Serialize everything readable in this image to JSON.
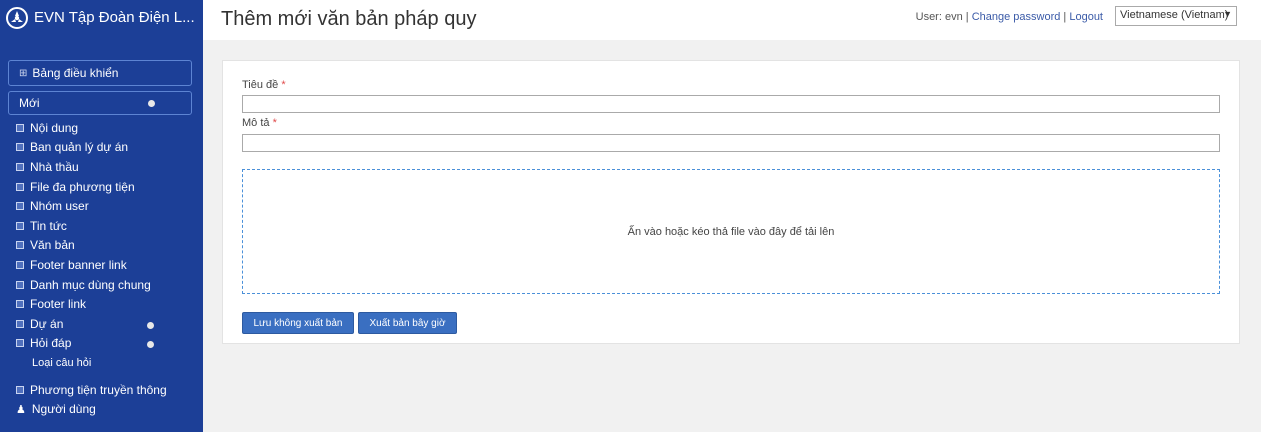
{
  "brand": {
    "title": "EVN Tập Đoàn Điện L..."
  },
  "sidebar": {
    "dashboard_label": "Bảng điều khiển",
    "new_label": "Mới",
    "items": [
      {
        "label": "Nội dung"
      },
      {
        "label": "Ban quản lý dự án"
      },
      {
        "label": "Nhà thầu"
      },
      {
        "label": "File đa phương tiện"
      },
      {
        "label": "Nhóm user"
      },
      {
        "label": "Tin tức"
      },
      {
        "label": "Văn bản"
      },
      {
        "label": "Footer banner link"
      },
      {
        "label": "Danh mục dùng chung"
      },
      {
        "label": "Footer link"
      },
      {
        "label": "Dự án"
      },
      {
        "label": "Hỏi đáp"
      },
      {
        "label": "Loại câu hỏi"
      },
      {
        "label": "Phương tiện truyền thông"
      },
      {
        "label": "Người dùng"
      }
    ]
  },
  "header": {
    "page_title": "Thêm mới văn bản pháp quy",
    "user_text": "User: evn",
    "change_password": "Change password",
    "logout": "Logout",
    "separator": "|",
    "language": "Vietnamese (Vietnam)"
  },
  "form": {
    "title_label": "Tiêu đề",
    "description_label": "Mô tả",
    "required_mark": "*",
    "title_value": "",
    "description_value": "",
    "dropzone_text": "Ấn vào hoặc kéo thả file vào đây để tải lên",
    "save_draft_label": "Lưu không xuất bản",
    "publish_label": "Xuất bản bây giờ"
  }
}
